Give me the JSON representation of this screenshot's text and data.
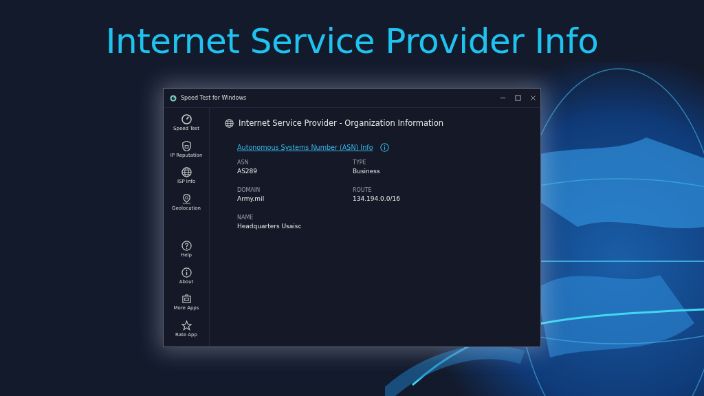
{
  "headline": "Internet Service Provider Info",
  "window": {
    "title": "Speed Test for Windows",
    "controls": [
      {
        "kind": "minimize"
      },
      {
        "kind": "maximize"
      },
      {
        "kind": "close"
      }
    ]
  },
  "sidebar": {
    "items": [
      {
        "label": "Speed Test"
      },
      {
        "label": "IP Reputation"
      },
      {
        "label": "ISP Info"
      },
      {
        "label": "Geolocation"
      },
      {
        "label": "Help"
      },
      {
        "label": "About"
      },
      {
        "label": "More Apps"
      },
      {
        "label": "Rate App"
      }
    ]
  },
  "content": {
    "heading": "Internet Service Provider - Organization Information",
    "link": "Autonomous Systems Number (ASN) Info",
    "fields": [
      {
        "label": "ASN",
        "value": "AS289"
      },
      {
        "label": "TYPE",
        "value": "Business"
      },
      {
        "label": "DOMAIN",
        "value": "Army.mil"
      },
      {
        "label": "ROUTE",
        "value": "134.194.0.0/16"
      },
      {
        "label": "NAME",
        "value": "Headquarters Usaisc"
      }
    ]
  }
}
